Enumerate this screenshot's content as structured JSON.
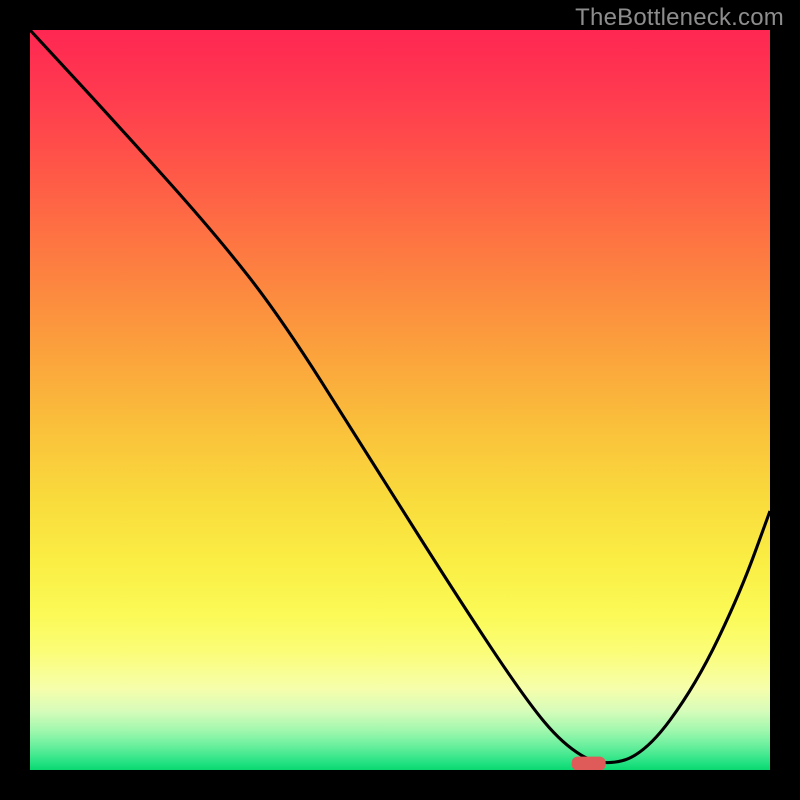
{
  "watermark": "TheBottleneck.com",
  "chart_data": {
    "type": "line",
    "title": "",
    "xlabel": "",
    "ylabel": "",
    "xlim": [
      0,
      1
    ],
    "ylim": [
      0,
      1
    ],
    "series": [
      {
        "name": "curve",
        "x": [
          0.0,
          0.12,
          0.25,
          0.34,
          0.46,
          0.58,
          0.67,
          0.72,
          0.77,
          0.83,
          0.9,
          0.96,
          1.0
        ],
        "y": [
          1.0,
          0.87,
          0.725,
          0.61,
          0.42,
          0.23,
          0.095,
          0.035,
          0.005,
          0.02,
          0.115,
          0.24,
          0.35
        ]
      }
    ],
    "marker": {
      "x": 0.755,
      "y": 0.006,
      "shape": "rounded-rect",
      "color": "#df5b5a"
    },
    "gradient_bands": [
      {
        "pos": 0.0,
        "color": "#ff2752"
      },
      {
        "pos": 0.09,
        "color": "#ff3b4f"
      },
      {
        "pos": 0.18,
        "color": "#ff5448"
      },
      {
        "pos": 0.27,
        "color": "#fe7043"
      },
      {
        "pos": 0.36,
        "color": "#fc8b3f"
      },
      {
        "pos": 0.45,
        "color": "#fba63c"
      },
      {
        "pos": 0.54,
        "color": "#fac13b"
      },
      {
        "pos": 0.63,
        "color": "#f9da3c"
      },
      {
        "pos": 0.72,
        "color": "#faee44"
      },
      {
        "pos": 0.79,
        "color": "#fbfa57"
      },
      {
        "pos": 0.84,
        "color": "#fbfd77"
      },
      {
        "pos": 0.89,
        "color": "#f6feab"
      },
      {
        "pos": 0.92,
        "color": "#d7fcba"
      },
      {
        "pos": 0.945,
        "color": "#a4f8af"
      },
      {
        "pos": 0.965,
        "color": "#6ff09f"
      },
      {
        "pos": 0.98,
        "color": "#43e88f"
      },
      {
        "pos": 0.992,
        "color": "#1de07e"
      },
      {
        "pos": 1.0,
        "color": "#0ad870"
      }
    ]
  }
}
